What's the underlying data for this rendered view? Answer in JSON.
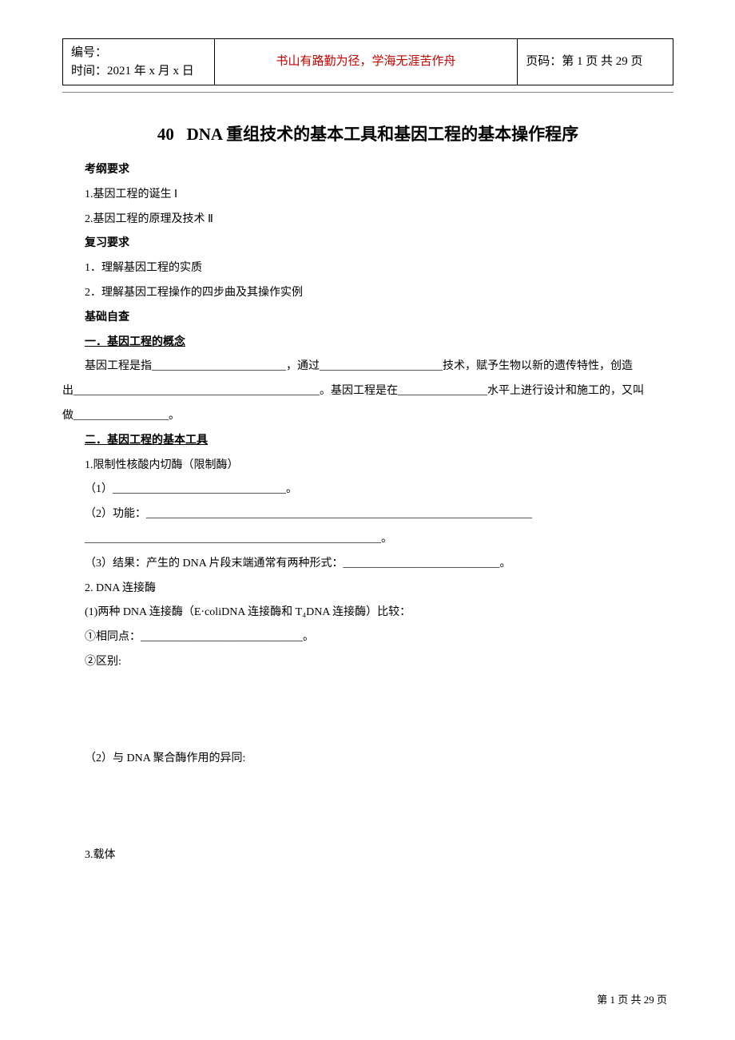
{
  "header": {
    "serial_label": "编号：",
    "date_label": "时间：",
    "date_value": "2021 年 x 月 x 日",
    "motto": "书山有路勤为径，学海无涯苦作舟",
    "page_label": "页码：",
    "page_value": "第 1 页  共 29 页"
  },
  "title": {
    "number": "40",
    "text": "DNA 重组技术的基本工具和基因工程的基本操作程序"
  },
  "sections": {
    "kgyq": "考纲要求",
    "kgyq_1": "1.基因工程的诞生       Ⅰ",
    "kgyq_2": "2.基因工程的原理及技术     Ⅱ",
    "fxyq": " 复习要求",
    "fxyq_1": "1．理解基因工程的实质",
    "fxyq_2": "2．理解基因工程操作的四步曲及其操作实例",
    "jczc": "基础自查",
    "s1_title": "一．基因工程的概念",
    "s1_p1a": "基因工程是指________________________，通过______________________技术，赋予生物以新的遗传特性，创造",
    "s1_p1b": "出____________________________________________。基因工程是在________________水平上进行设计和施工的，又叫",
    "s1_p1c": "做_________________。",
    "s2_title": "二．基因工程的基本工具",
    "s2_1": "1.限制性核酸内切酶（限制酶）",
    "s2_1_1": "（1）_______________________________。",
    "s2_1_2": "（2）功能：_____________________________________________________________________",
    "s2_1_2b": "_____________________________________________________。",
    "s2_1_3": "（3）结果：产生的 DNA 片段末端通常有两种形式：____________________________。",
    "s2_2": "2. DNA 连接酶",
    "s2_2_1": "(1)两种 DNA 连接酶（E·coliDNA 连接酶和 T₄DNA 连接酶）比较：",
    "s2_2_1a": "①相同点：_____________________________。",
    "s2_2_1b": "②区别:",
    "s2_2_2": "（2）与 DNA 聚合酶作用的异同:",
    "s2_3": "3.载体"
  },
  "footer": {
    "text": "第  1  页  共  29  页"
  }
}
